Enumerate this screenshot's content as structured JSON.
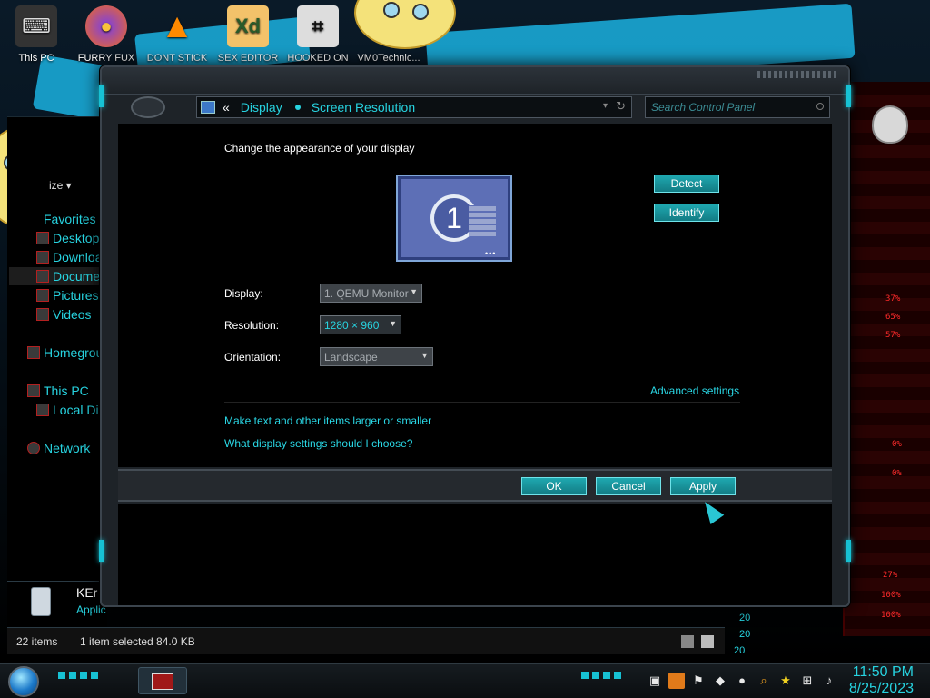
{
  "desktop": {
    "icons": [
      {
        "label": "This PC",
        "glyph": "⌨"
      },
      {
        "label": "FURRY FUX",
        "glyph": "●"
      },
      {
        "label": "DONT STICK",
        "glyph": "▲"
      },
      {
        "label": "SEX EDITOR",
        "glyph": "Xd"
      },
      {
        "label": "HOOKED ON",
        "glyph": "⌗"
      },
      {
        "label": "VM0Technic...",
        "glyph": ""
      }
    ],
    "red_panel_readouts": [
      "37%",
      "65%",
      "57%",
      "0%",
      "0%",
      "27%",
      "100%",
      "100%"
    ]
  },
  "explorer": {
    "view_button": "ize",
    "favorites": "Favorites",
    "nav": [
      "Desktop",
      "Downloac",
      "Documen",
      "Pictures",
      "Videos",
      "Homegroup",
      "This PC",
      "Local Dis",
      "Network"
    ],
    "file_name": "KEr",
    "file_type": "Applic",
    "status_items": "22 items",
    "status_selected": "1 item selected  84.0 KB",
    "side_numbers": [
      "20",
      "20",
      "20"
    ]
  },
  "dialog": {
    "breadcrumb_back": "«",
    "breadcrumb_1": "Display",
    "breadcrumb_2": "Screen Resolution",
    "search_placeholder": "Search Control Panel",
    "heading": "Change the appearance of your display",
    "monitor_number": "1",
    "detect": "Detect",
    "identify": "Identify",
    "display_label": "Display:",
    "display_value": "1. QEMU Monitor",
    "resolution_label": "Resolution:",
    "resolution_value": "1280 × 960",
    "orientation_label": "Orientation:",
    "orientation_value": "Landscape",
    "advanced": "Advanced settings",
    "link_text_size": "Make text and other items larger or smaller",
    "link_help": "What display settings should I choose?",
    "ok": "OK",
    "cancel": "Cancel",
    "apply": "Apply"
  },
  "taskbar": {
    "time": "11:50 PM",
    "date": "8/25/2023"
  },
  "colors": {
    "accent": "#27d3e0",
    "button": "#1fa8b0",
    "alert": "#ff2a2a"
  }
}
